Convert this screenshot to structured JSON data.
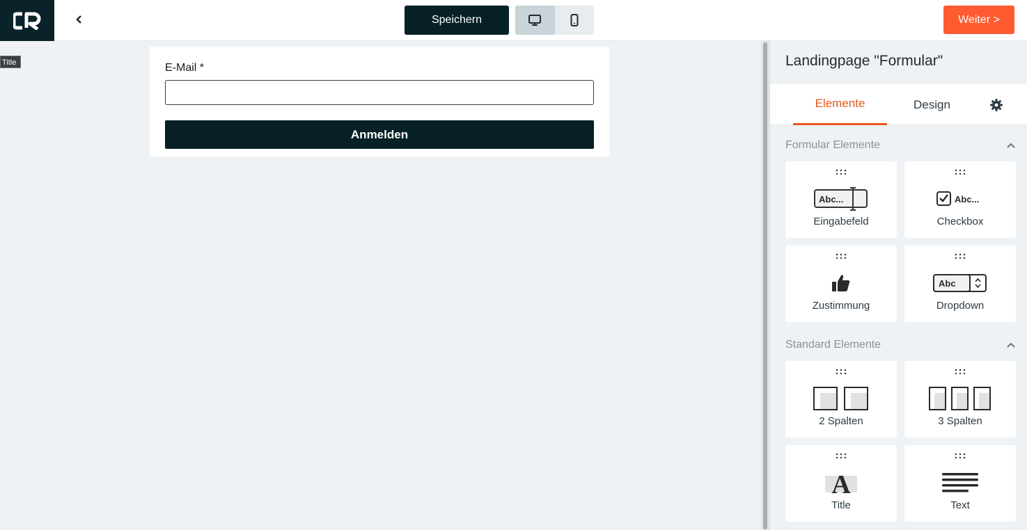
{
  "header": {
    "logo_text": "CR",
    "save_label": "Speichern",
    "next_label": "Weiter >"
  },
  "canvas": {
    "tooltip": "Title",
    "field_label": "E-Mail *",
    "field_value": "",
    "submit_label": "Anmelden"
  },
  "panel": {
    "title": "Landingpage \"Formular\"",
    "tabs": [
      {
        "label": "Elemente",
        "active": true
      },
      {
        "label": "Design",
        "active": false
      }
    ],
    "sections": [
      {
        "title": "Formular Elemente",
        "items": [
          {
            "label": "Eingabefeld",
            "icon": "input-field-icon",
            "icon_text": "Abc..."
          },
          {
            "label": "Checkbox",
            "icon": "checkbox-icon",
            "icon_text": "Abc..."
          },
          {
            "label": "Zustimmung",
            "icon": "thumbs-up-icon"
          },
          {
            "label": "Dropdown",
            "icon": "dropdown-icon",
            "icon_text": "Abc"
          }
        ]
      },
      {
        "title": "Standard Elemente",
        "items": [
          {
            "label": "2 Spalten",
            "icon": "two-columns-icon"
          },
          {
            "label": "3 Spalten",
            "icon": "three-columns-icon"
          },
          {
            "label": "Title",
            "icon": "title-icon",
            "icon_text": "A"
          },
          {
            "label": "Text",
            "icon": "text-icon"
          }
        ]
      }
    ]
  },
  "colors": {
    "brand_dark": "#062026",
    "accent_orange": "#ff5a30",
    "tab_active": "#e8581e"
  }
}
